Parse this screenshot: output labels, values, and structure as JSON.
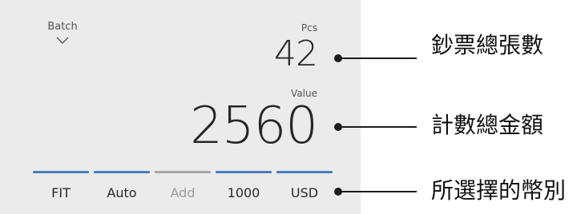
{
  "display": {
    "batch": {
      "label": "Batch",
      "icon": "chevron-down-icon"
    },
    "pcs": {
      "label": "Pcs",
      "value": "42"
    },
    "amount": {
      "label": "Value",
      "value": "2560"
    },
    "tabs": [
      {
        "label": "FIT",
        "state": "active"
      },
      {
        "label": "Auto",
        "state": "active"
      },
      {
        "label": "Add",
        "state": "disabled"
      },
      {
        "label": "1000",
        "state": "active"
      },
      {
        "label": "USD",
        "state": "active"
      }
    ]
  },
  "annotations": {
    "pcs_callout": "鈔票總張數",
    "value_callout": "計數總金額",
    "tabs_callout": "所選擇的幣別"
  },
  "colors": {
    "panel_background": "#ebebeb",
    "active_bar": "#4a7ebd",
    "disabled_bar": "#a6a6a6",
    "text": "#262626"
  }
}
